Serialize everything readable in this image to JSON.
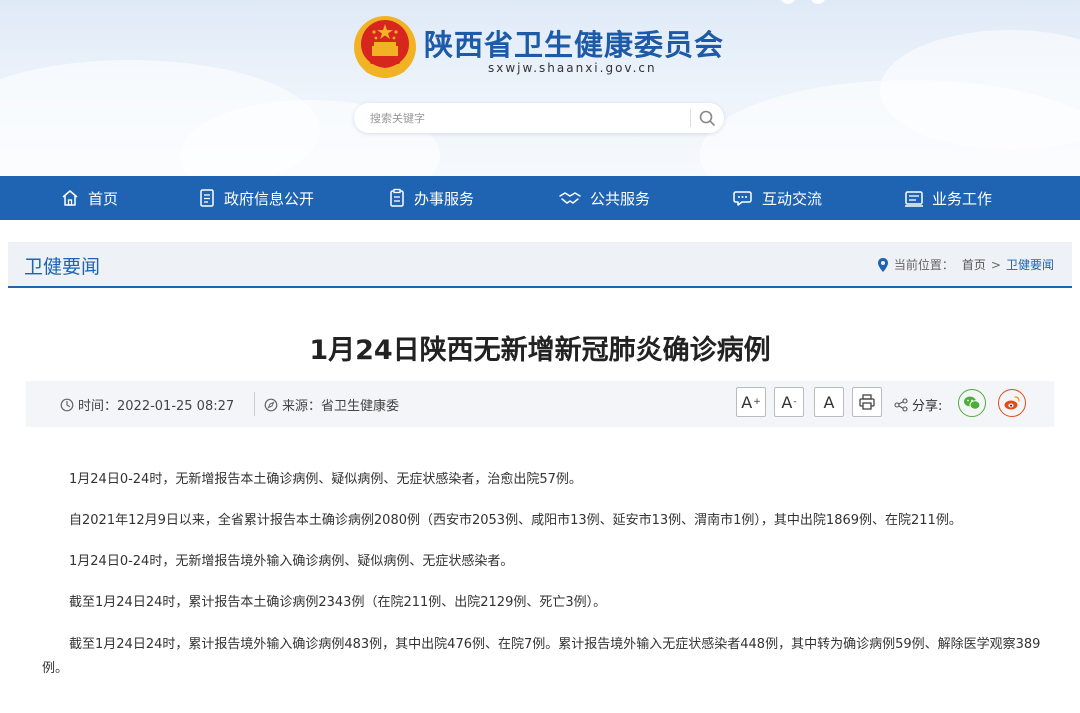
{
  "site": {
    "title": "陕西省卫生健康委员会",
    "domain": "sxwjw.shaanxi.gov.cn",
    "search_placeholder": "搜索关键字"
  },
  "nav": {
    "items": [
      {
        "label": "首页",
        "icon": "home-icon"
      },
      {
        "label": "政府信息公开",
        "icon": "document-icon"
      },
      {
        "label": "办事服务",
        "icon": "clipboard-icon"
      },
      {
        "label": "公共服务",
        "icon": "handshake-icon"
      },
      {
        "label": "互动交流",
        "icon": "chat-icon"
      },
      {
        "label": "业务工作",
        "icon": "briefcase-icon"
      }
    ]
  },
  "section": {
    "title": "卫健要闻",
    "location_label": "当前位置：",
    "breadcrumb": [
      "首页",
      "卫健要闻"
    ],
    "separator": ">"
  },
  "article": {
    "title": "1月24日陕西无新增新冠肺炎确诊病例",
    "time_label": "时间：2022-01-25 08:27",
    "source_label": "来源：省卫生健康委",
    "share_label": "分享:",
    "font_buttons": {
      "increase": "A",
      "decrease": "A",
      "reset": "A"
    },
    "paragraphs": [
      "1月24日0-24时，无新增报告本土确诊病例、疑似病例、无症状感染者，治愈出院57例。",
      "自2021年12月9日以来，全省累计报告本土确诊病例2080例（西安市2053例、咸阳市13例、延安市13例、渭南市1例），其中出院1869例、在院211例。",
      "1月24日0-24时，无新增报告境外输入确诊病例、疑似病例、无症状感染者。",
      "截至1月24日24时，累计报告本土确诊病例2343例（在院211例、出院2129例、死亡3例）。",
      "截至1月24日24时，累计报告境外输入确诊病例483例，其中出院476例、在院7例。累计报告境外输入无症状感染者448例，其中转为确诊病例59例、解除医学观察389例。"
    ]
  },
  "colors": {
    "nav_bg": "#1e64b3",
    "title_blue": "#1d5aa8",
    "wechat_green": "#4caf38",
    "weibo_red": "#e64a19"
  }
}
